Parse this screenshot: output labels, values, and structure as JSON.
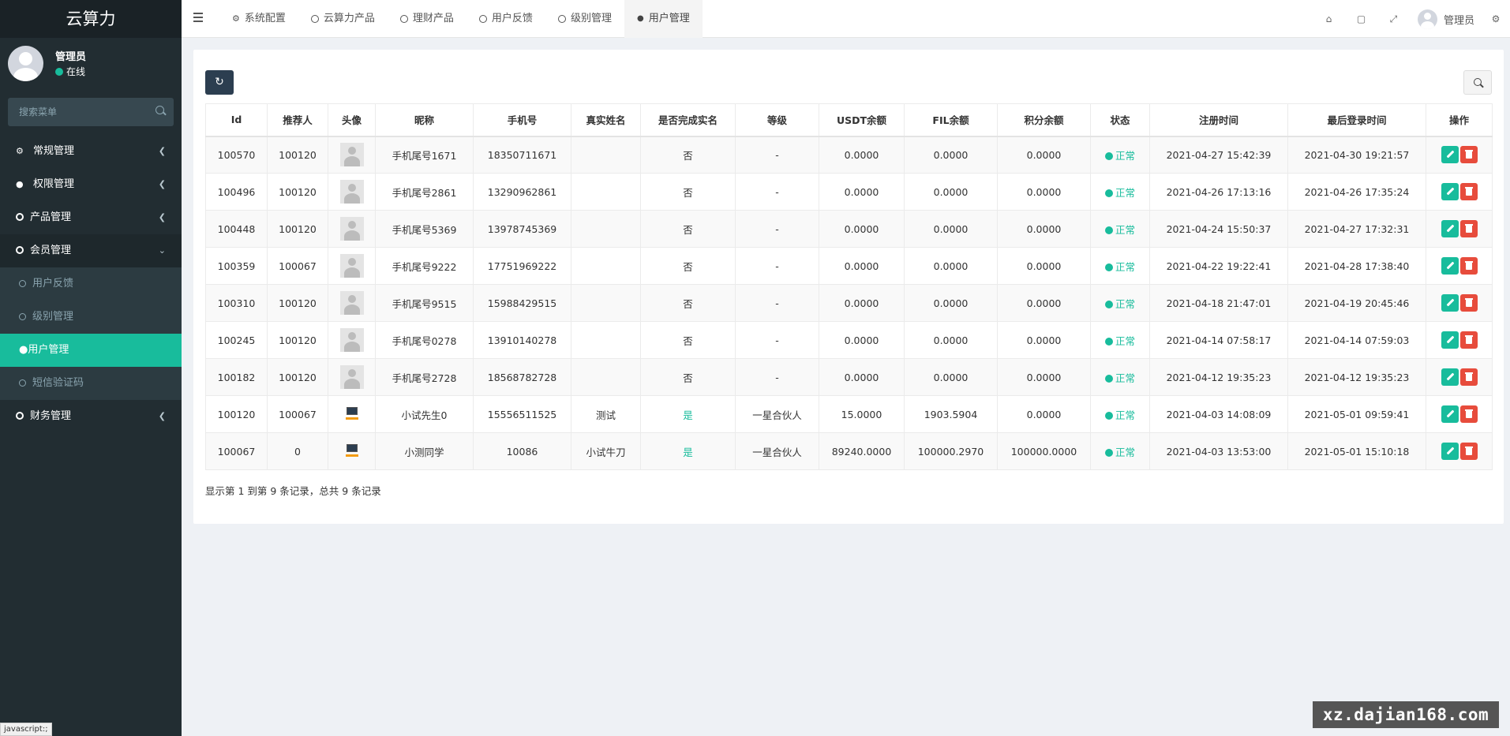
{
  "brand": "云算力",
  "user": {
    "name": "管理员",
    "status": "在线"
  },
  "sidebar": {
    "search_placeholder": "搜索菜单",
    "items": [
      {
        "label": "常规管理",
        "icon": "cogs-icon"
      },
      {
        "label": "权限管理",
        "icon": "users-icon"
      },
      {
        "label": "产品管理",
        "icon": "circle-icon"
      },
      {
        "label": "会员管理",
        "icon": "circle-icon"
      },
      {
        "label": "财务管理",
        "icon": "circle-icon"
      }
    ],
    "sub_items": [
      {
        "label": "用户反馈"
      },
      {
        "label": "级别管理"
      },
      {
        "label": "用户管理"
      },
      {
        "label": "短信验证码"
      }
    ]
  },
  "status_tip": "javascript:;",
  "topbar": {
    "tabs": [
      {
        "label": "系统配置",
        "icon": "gear-icon"
      },
      {
        "label": "云算力产品",
        "icon": "circle-icon"
      },
      {
        "label": "理财产品",
        "icon": "circle-icon"
      },
      {
        "label": "用户反馈",
        "icon": "circle-icon"
      },
      {
        "label": "级别管理",
        "icon": "circle-icon"
      },
      {
        "label": "用户管理",
        "icon": "user-icon"
      }
    ],
    "user_name": "管理员"
  },
  "table": {
    "headers": [
      "Id",
      "推荐人",
      "头像",
      "昵称",
      "手机号",
      "真实姓名",
      "是否完成实名",
      "等级",
      "USDT余额",
      "FIL余额",
      "积分余额",
      "状态",
      "注册时间",
      "最后登录时间",
      "操作"
    ],
    "rows": [
      {
        "id": "100570",
        "ref": "100120",
        "avatar": "placeholder",
        "nick": "手机尾号1671",
        "phone": "18350711671",
        "real": "",
        "verified": "否",
        "level": "-",
        "usdt": "0.0000",
        "fil": "0.0000",
        "points": "0.0000",
        "status": "正常",
        "reg": "2021-04-27 15:42:39",
        "last": "2021-04-30 19:21:57"
      },
      {
        "id": "100496",
        "ref": "100120",
        "avatar": "placeholder",
        "nick": "手机尾号2861",
        "phone": "13290962861",
        "real": "",
        "verified": "否",
        "level": "-",
        "usdt": "0.0000",
        "fil": "0.0000",
        "points": "0.0000",
        "status": "正常",
        "reg": "2021-04-26 17:13:16",
        "last": "2021-04-26 17:35:24"
      },
      {
        "id": "100448",
        "ref": "100120",
        "avatar": "placeholder",
        "nick": "手机尾号5369",
        "phone": "13978745369",
        "real": "",
        "verified": "否",
        "level": "-",
        "usdt": "0.0000",
        "fil": "0.0000",
        "points": "0.0000",
        "status": "正常",
        "reg": "2021-04-24 15:50:37",
        "last": "2021-04-27 17:32:31"
      },
      {
        "id": "100359",
        "ref": "100067",
        "avatar": "placeholder",
        "nick": "手机尾号9222",
        "phone": "17751969222",
        "real": "",
        "verified": "否",
        "level": "-",
        "usdt": "0.0000",
        "fil": "0.0000",
        "points": "0.0000",
        "status": "正常",
        "reg": "2021-04-22 19:22:41",
        "last": "2021-04-28 17:38:40"
      },
      {
        "id": "100310",
        "ref": "100120",
        "avatar": "placeholder",
        "nick": "手机尾号9515",
        "phone": "15988429515",
        "real": "",
        "verified": "否",
        "level": "-",
        "usdt": "0.0000",
        "fil": "0.0000",
        "points": "0.0000",
        "status": "正常",
        "reg": "2021-04-18 21:47:01",
        "last": "2021-04-19 20:45:46"
      },
      {
        "id": "100245",
        "ref": "100120",
        "avatar": "placeholder",
        "nick": "手机尾号0278",
        "phone": "13910140278",
        "real": "",
        "verified": "否",
        "level": "-",
        "usdt": "0.0000",
        "fil": "0.0000",
        "points": "0.0000",
        "status": "正常",
        "reg": "2021-04-14 07:58:17",
        "last": "2021-04-14 07:59:03"
      },
      {
        "id": "100182",
        "ref": "100120",
        "avatar": "placeholder",
        "nick": "手机尾号2728",
        "phone": "18568782728",
        "real": "",
        "verified": "否",
        "level": "-",
        "usdt": "0.0000",
        "fil": "0.0000",
        "points": "0.0000",
        "status": "正常",
        "reg": "2021-04-12 19:35:23",
        "last": "2021-04-12 19:35:23"
      },
      {
        "id": "100120",
        "ref": "100067",
        "avatar": "image",
        "nick": "小试先生0",
        "phone": "15556511525",
        "real": "测试",
        "verified": "是",
        "level": "一星合伙人",
        "usdt": "15.0000",
        "fil": "1903.5904",
        "points": "0.0000",
        "status": "正常",
        "reg": "2021-04-03 14:08:09",
        "last": "2021-05-01 09:59:41"
      },
      {
        "id": "100067",
        "ref": "0",
        "avatar": "image",
        "nick": "小测同学",
        "phone": "10086",
        "real": "小试牛刀",
        "verified": "是",
        "level": "一星合伙人",
        "usdt": "89240.0000",
        "fil": "100000.2970",
        "points": "100000.0000",
        "status": "正常",
        "reg": "2021-04-03 13:53:00",
        "last": "2021-05-01 15:10:18"
      }
    ]
  },
  "pager_info": "显示第 1 到第 9 条记录，总共 9 条记录",
  "watermark": "xz.dajian168.com",
  "colors": {
    "accent": "#18bc9c",
    "danger": "#e74c3c",
    "sidebar": "#222d32",
    "dark_button": "#2c3e50"
  }
}
